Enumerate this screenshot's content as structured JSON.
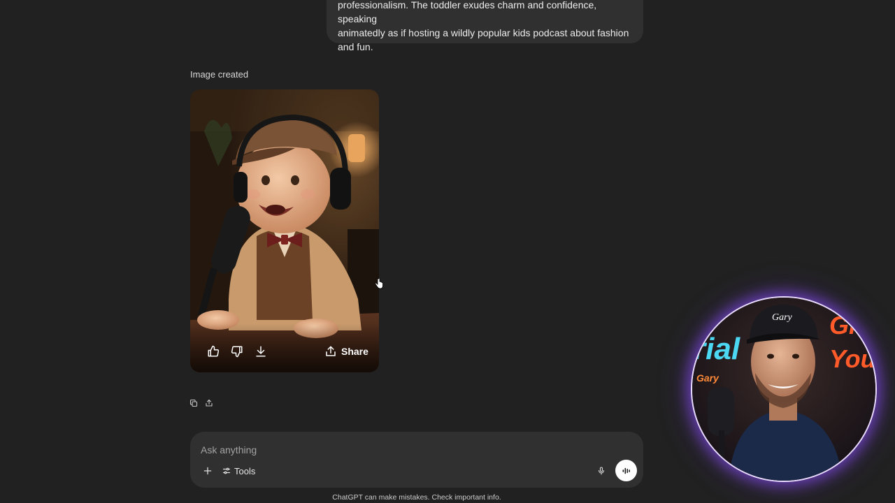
{
  "conversation": {
    "user_message": {
      "lines": [
        "professionalism. The toddler exudes charm and confidence, speaking",
        "animatedly as if hosting a wildly popular kids podcast about fashion",
        "and fun."
      ]
    },
    "assistant": {
      "status_label": "Image created",
      "image_actions": {
        "like_icon": "thumbs-up-icon",
        "dislike_icon": "thumbs-down-icon",
        "download_icon": "download-icon",
        "share_label": "Share",
        "share_icon": "share-icon"
      },
      "message_actions": [
        "copy-icon",
        "share-icon"
      ]
    }
  },
  "composer": {
    "placeholder": "Ask anything",
    "tools_label": "Tools",
    "plus_icon": "plus-icon",
    "tools_icon": "sliders-icon",
    "mic_icon": "microphone-icon",
    "voice_icon": "voice-mode-icon"
  },
  "footer": {
    "disclaimer": "ChatGPT can make mistakes. Check important info."
  },
  "webcam_overlay": {
    "cap_text": "Gary",
    "neon_left": "rial",
    "neon_left_small": "Gary",
    "neon_right": [
      "Gr",
      "You"
    ]
  },
  "colors": {
    "background": "#212121",
    "bubble": "#303030",
    "text": "#ececec",
    "webcam_glow": "#8c50ff"
  }
}
